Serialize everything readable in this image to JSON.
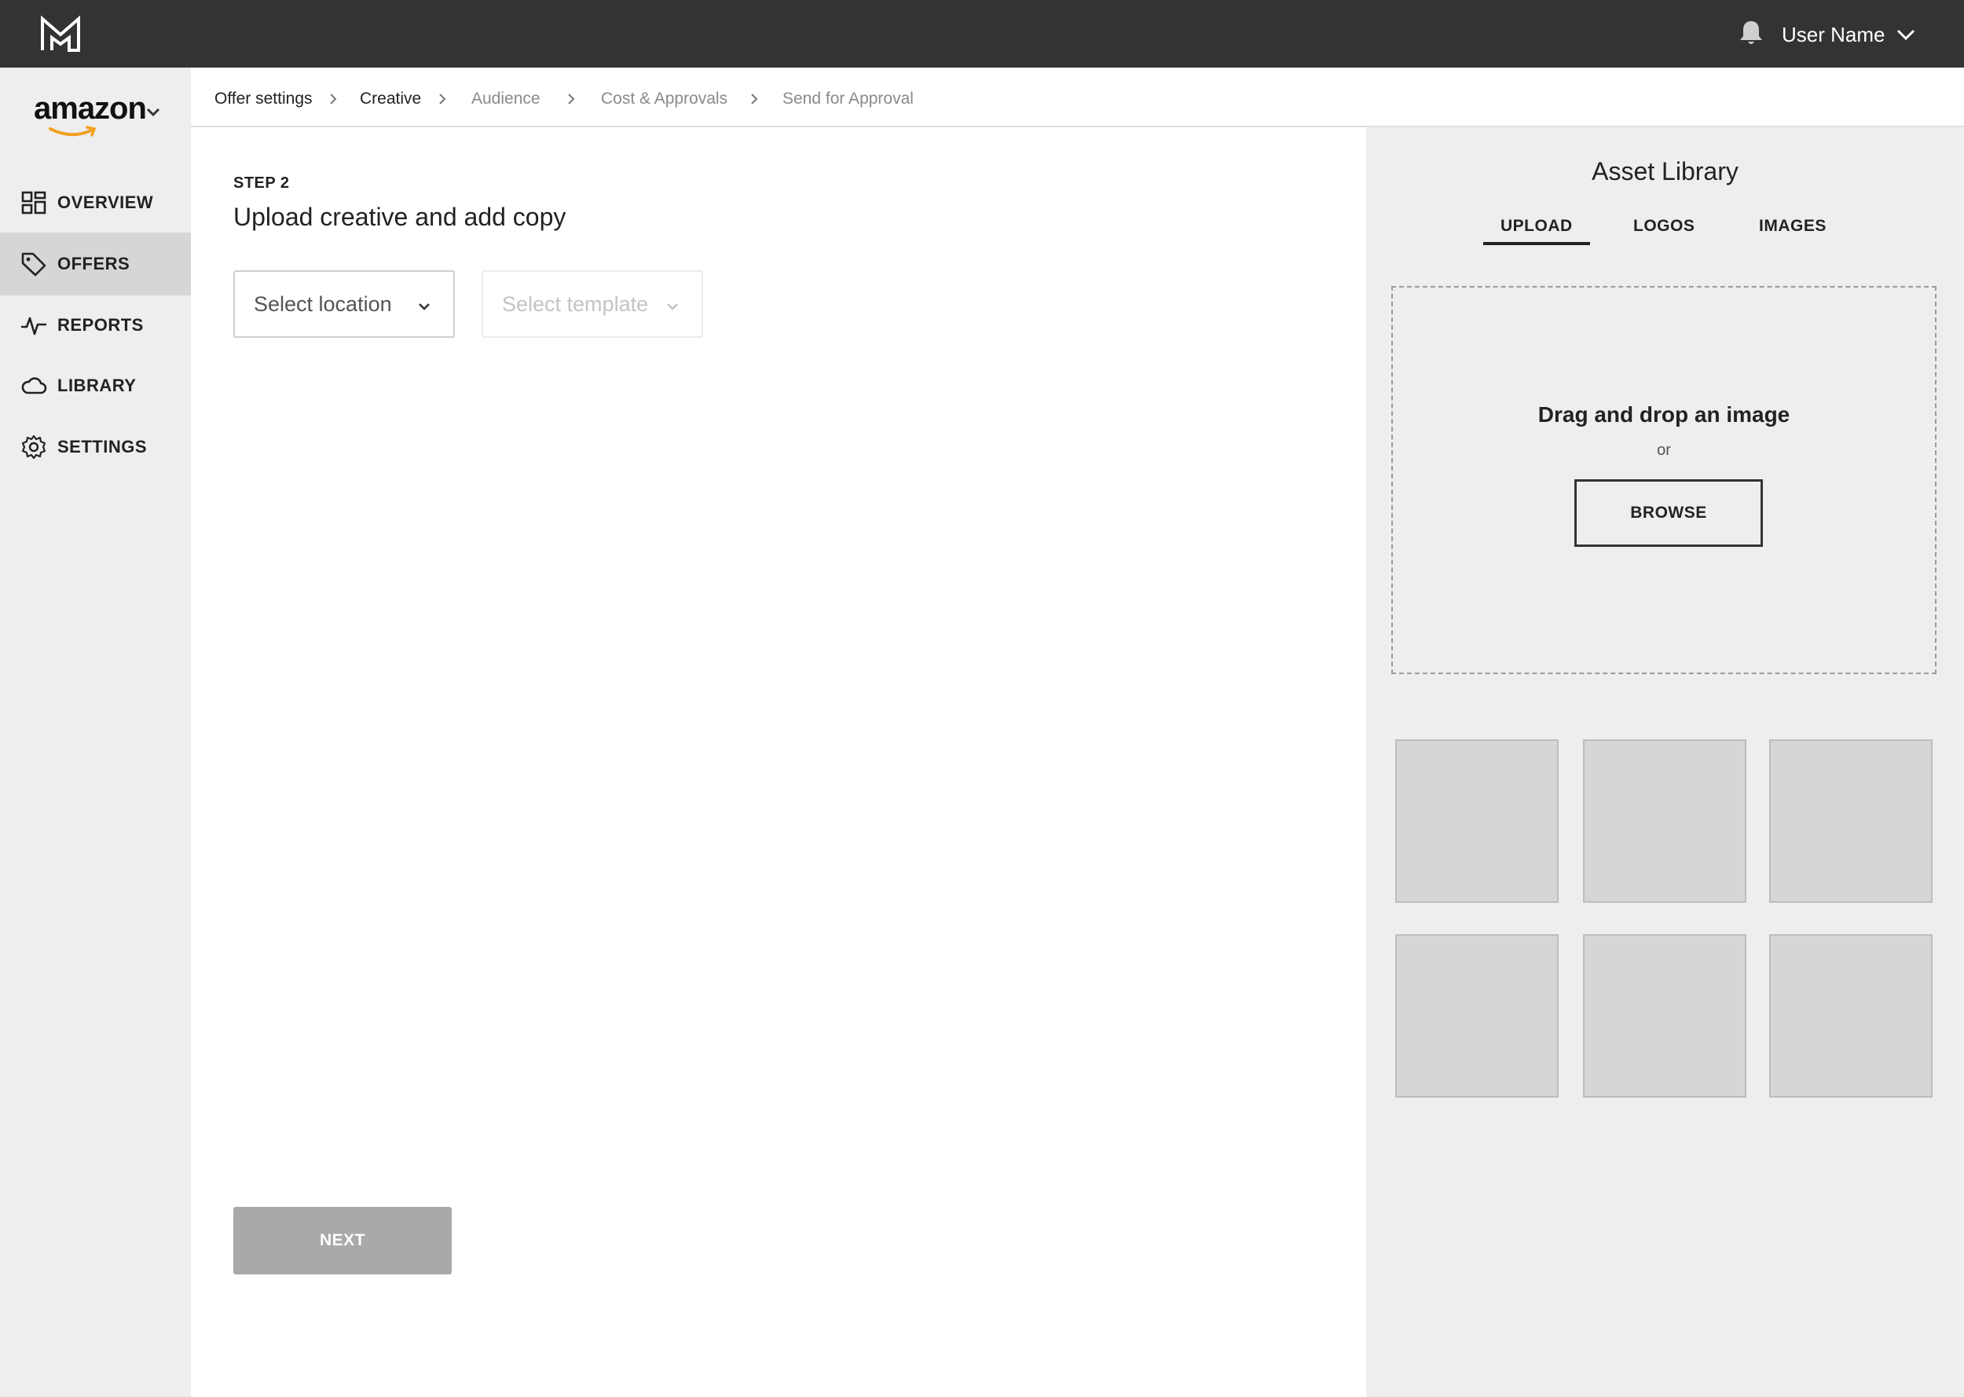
{
  "header": {
    "logo": "m-logo-icon",
    "notification_icon": "bell-icon",
    "user_name": "User Name"
  },
  "sidebar": {
    "account": {
      "name": "amazon",
      "logo_icon": "amazon-smile-icon"
    },
    "items": [
      {
        "label": "OVERVIEW",
        "icon": "grid-icon",
        "active": false
      },
      {
        "label": "OFFERS",
        "icon": "tag-icon",
        "active": true
      },
      {
        "label": "REPORTS",
        "icon": "pulse-icon",
        "active": false
      },
      {
        "label": "LIBRARY",
        "icon": "cloud-icon",
        "active": false
      },
      {
        "label": "SETTINGS",
        "icon": "gear-icon",
        "active": false
      }
    ]
  },
  "breadcrumb": [
    {
      "label": "Offer settings",
      "state": "done"
    },
    {
      "label": "Creative",
      "state": "current"
    },
    {
      "label": "Audience",
      "state": "todo"
    },
    {
      "label": "Cost & Approvals",
      "state": "todo"
    },
    {
      "label": "Send for Approval",
      "state": "todo"
    }
  ],
  "main": {
    "step_label": "STEP 2",
    "title": "Upload creative and add copy",
    "location_select": {
      "placeholder": "Select location",
      "enabled": true
    },
    "template_select": {
      "placeholder": "Select template",
      "enabled": false
    },
    "next_label": "NEXT"
  },
  "asset_library": {
    "title": "Asset Library",
    "tabs": [
      {
        "label": "UPLOAD",
        "active": true
      },
      {
        "label": "LOGOS",
        "active": false
      },
      {
        "label": "IMAGES",
        "active": false
      }
    ],
    "dropzone": {
      "title": "Drag and drop an image",
      "or": "or",
      "browse_label": "BROWSE"
    }
  },
  "colors": {
    "topbar": "#333333",
    "sidebar": "#eeeeee",
    "active_nav": "#d6d6d6",
    "disabled_button": "#a9a9a9",
    "amazon_smile": "#f0a020"
  }
}
